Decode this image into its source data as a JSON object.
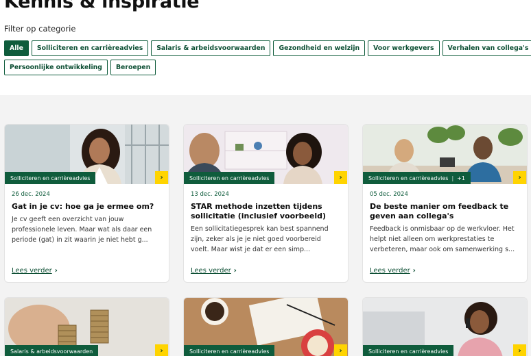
{
  "header": {
    "title": "Kennis & inspiratie",
    "filter_label": "Filter op categorie"
  },
  "filters": [
    {
      "label": "Alle",
      "active": true
    },
    {
      "label": "Solliciteren en carrièreadvies",
      "active": false
    },
    {
      "label": "Salaris & arbeidsvoorwaarden",
      "active": false
    },
    {
      "label": "Gezondheid en welzijn",
      "active": false
    },
    {
      "label": "Voor werkgevers",
      "active": false
    },
    {
      "label": "Verhalen van collega's",
      "active": false
    },
    {
      "label": "Persoonlijke ontwikkeling",
      "active": false
    },
    {
      "label": "Beroepen",
      "active": false
    }
  ],
  "cards": [
    {
      "tag": "Solliciteren en carrièreadvies",
      "extra": "",
      "date": "26 dec. 2024",
      "title": "Gat in je cv: hoe ga je ermee om?",
      "excerpt": "Je cv geeft een overzicht van jouw professionele leven. Maar wat als daar een periode (gat) in zit waarin je niet hebt g...",
      "read_more": "Lees verder"
    },
    {
      "tag": "Solliciteren en carrièreadvies",
      "extra": "",
      "date": "13 dec. 2024",
      "title": "STAR methode inzetten tijdens sollicitatie (inclusief voorbeeld)",
      "excerpt": "Een sollicitatiegesprek kan best spannend zijn, zeker als je je niet goed voorbereid voelt. Maar wist je dat er een simp...",
      "read_more": "Lees verder"
    },
    {
      "tag": "Solliciteren en carrièreadvies",
      "extra": "+1",
      "date": "05 dec. 2024",
      "title": "De beste manier om feedback te geven aan collega's",
      "excerpt": "Feedback is onmisbaar op de werkvloer. Het helpt niet alleen om werkprestaties te verbeteren, maar ook om samenwerking s...",
      "read_more": "Lees verder"
    },
    {
      "tag": "Salaris & arbeidsvoorwaarden",
      "extra": ""
    },
    {
      "tag": "Solliciteren en carrièreadvies",
      "extra": ""
    },
    {
      "tag": "Solliciteren en carrièreadvies",
      "extra": ""
    }
  ],
  "icons": {
    "arrow": "chevron-right-icon"
  },
  "colors": {
    "brand_green": "#0f5c3c",
    "accent_yellow": "#ffd400",
    "section_bg": "#f3f3f3"
  }
}
